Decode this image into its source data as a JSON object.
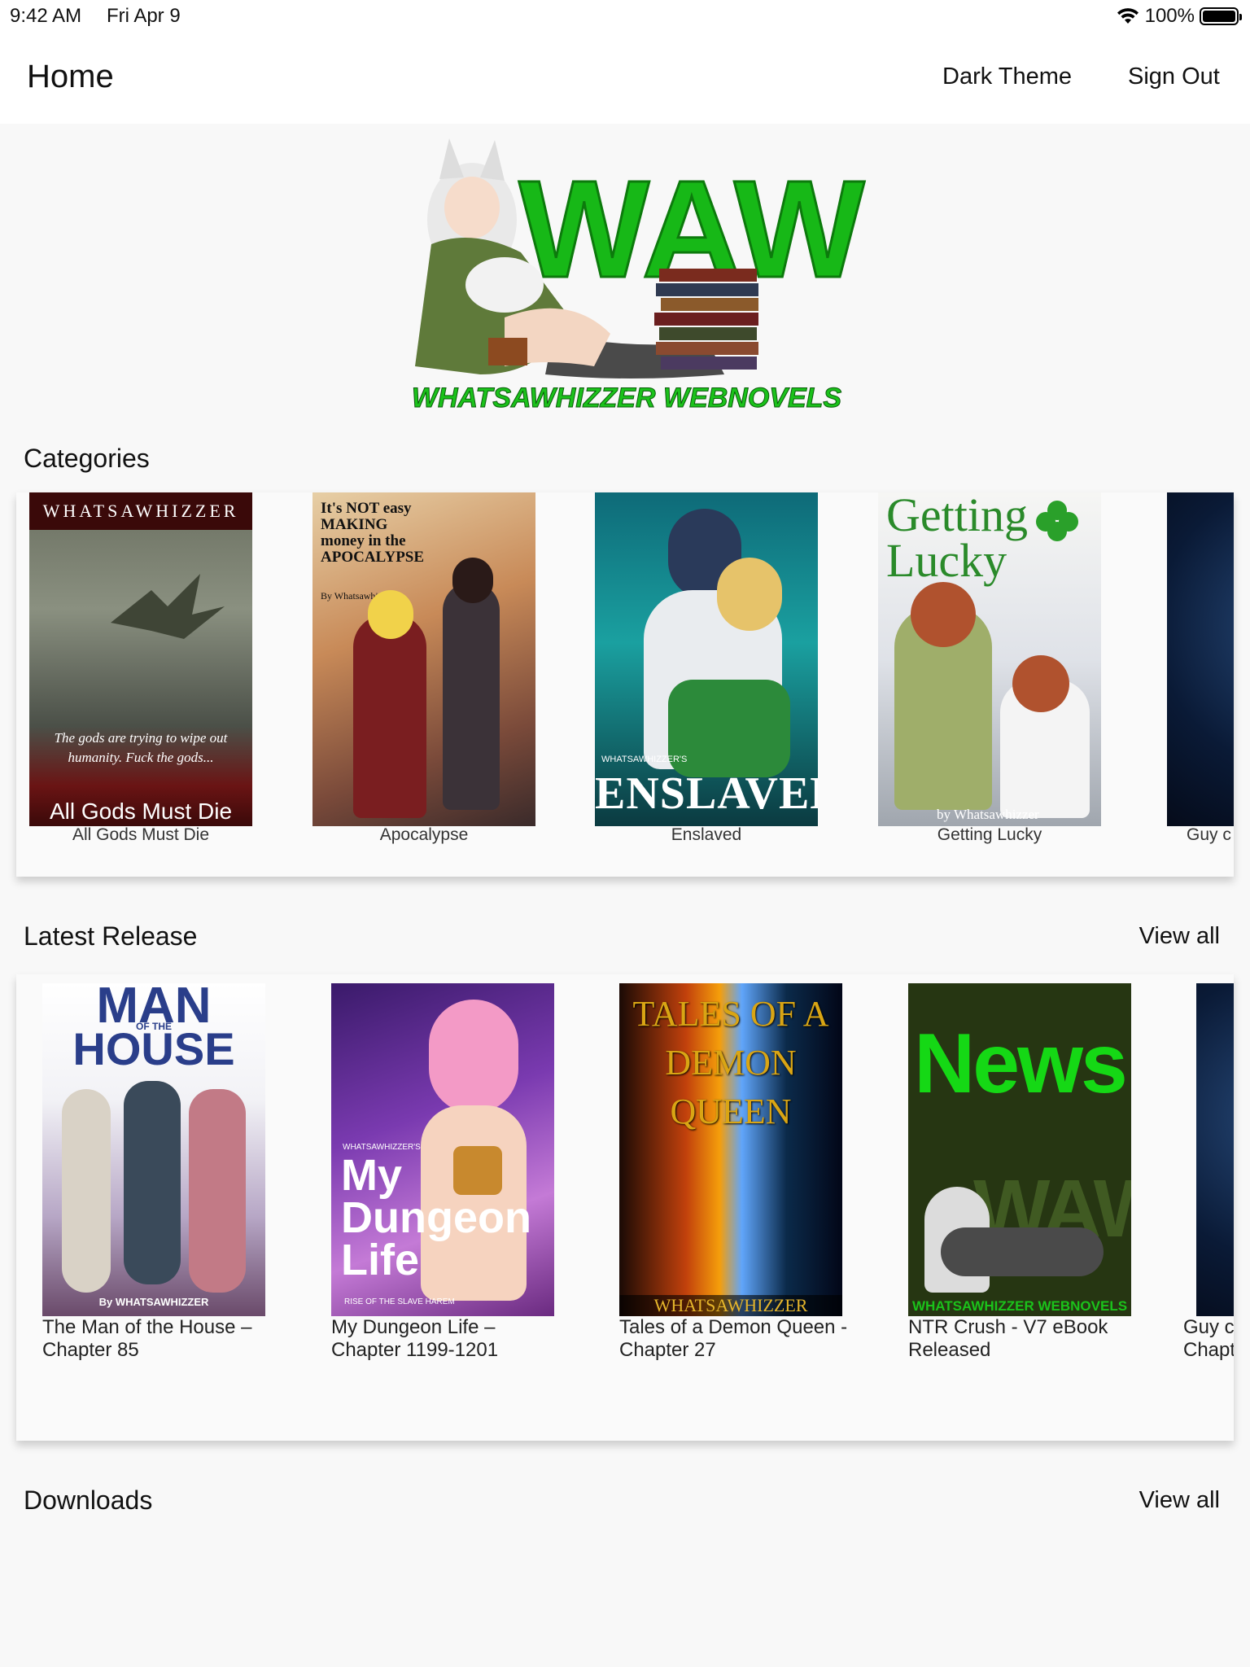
{
  "status": {
    "time": "9:42 AM",
    "date": "Fri Apr 9",
    "battery": "100%",
    "battery_level": 1.0
  },
  "appbar": {
    "title": "Home",
    "dark_theme": "Dark Theme",
    "sign_out": "Sign Out"
  },
  "logo": {
    "letters": "WAW",
    "subtitle": "WHATSAWHIZZER WEBNOVELS",
    "brand_color": "#1bc21b"
  },
  "categories": {
    "title": "Categories",
    "items": [
      {
        "label": "All Gods Must Die",
        "cover_top": "WHATSAWHIZZER",
        "cover_quote": "The gods are trying to wipe out humanity. Fuck the gods...",
        "cover_title": "All Gods Must Die"
      },
      {
        "label": "Apocalypse",
        "cover_title": "It's NOT easy MAKING money in the APOCALYPSE",
        "cover_by": "By Whatsawhizzer"
      },
      {
        "label": "Enslaved",
        "cover_small": "WHATSAWHIZZER'S",
        "cover_title": "ENSLAVED"
      },
      {
        "label": "Getting Lucky",
        "cover_title": "Getting Lucky",
        "cover_by": "by Whatsawhizzer"
      },
      {
        "label": "Guy c"
      }
    ]
  },
  "latest": {
    "title": "Latest Release",
    "view_all": "View all",
    "items": [
      {
        "line1": "The Man of the House –",
        "line2": "Chapter 85",
        "cover_title1": "MAN",
        "cover_title2": "OF THE",
        "cover_title3": "HOUSE",
        "cover_by": "By WHATSAWHIZZER"
      },
      {
        "line1": "My Dungeon Life –",
        "line2": "Chapter 1199-1201",
        "cover_small": "WHATSAWHIZZER'S",
        "cover_title": "My Dungeon Life",
        "cover_sub": "RISE OF THE SLAVE HAREM"
      },
      {
        "line1": "Tales of a Demon Queen -",
        "line2": "Chapter 27",
        "cover_title": "TALES OF A DEMON QUEEN",
        "cover_by": "WHATSAWHIZZER"
      },
      {
        "line1": "NTR Crush - V7 eBook",
        "line2": "Released",
        "cover_title": "News",
        "cover_sub": "WHATSAWHIZZER WEBNOVELS",
        "cover_letters": "WAW"
      },
      {
        "line1": "Guy c",
        "line2": "Chapt"
      }
    ]
  },
  "downloads": {
    "title": "Downloads",
    "view_all": "View all"
  }
}
